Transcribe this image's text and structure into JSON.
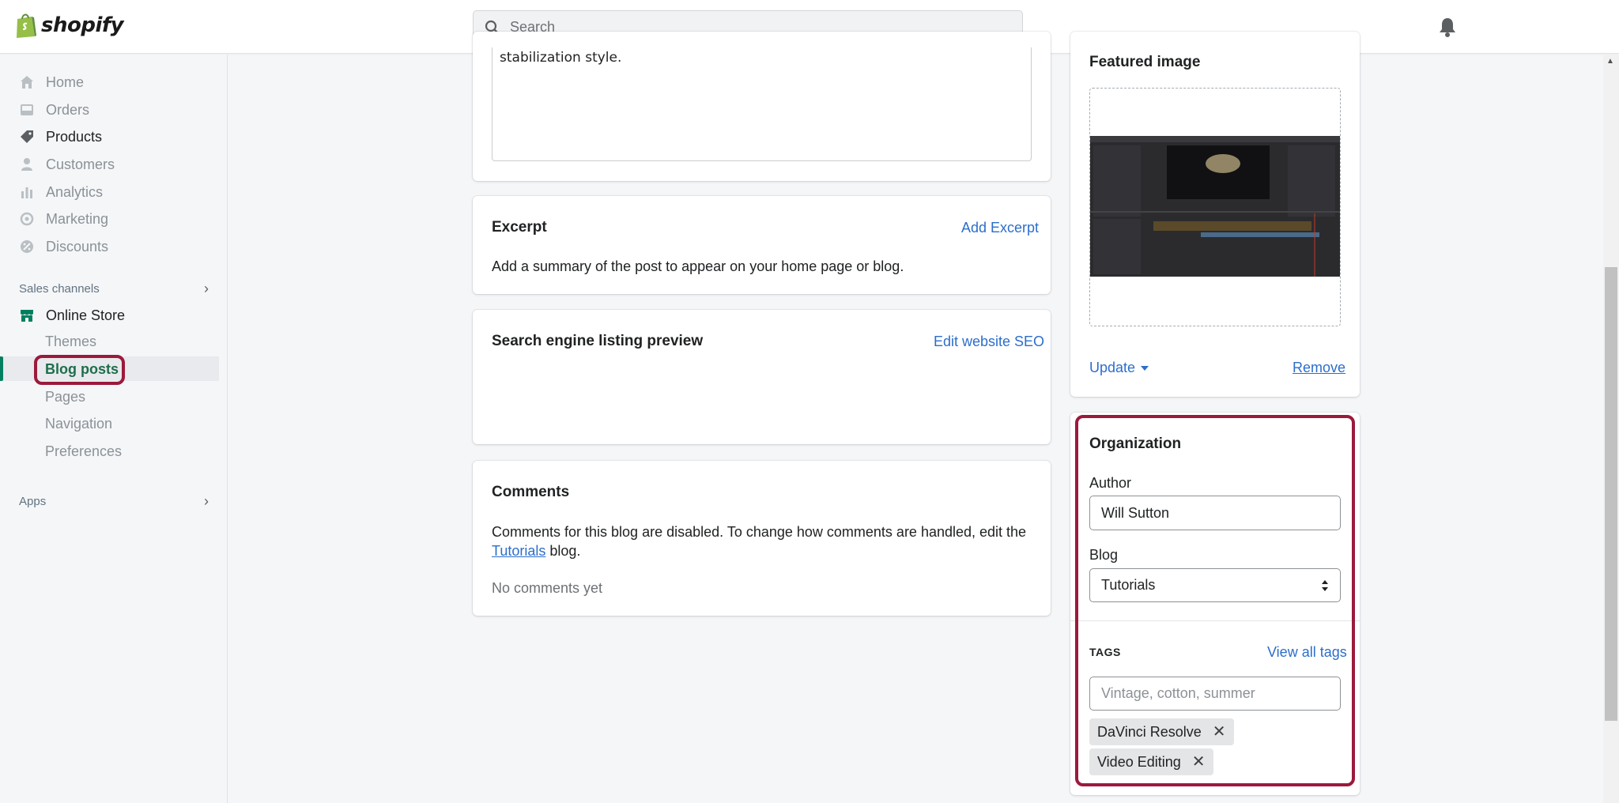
{
  "topbar": {
    "brand": "shopify",
    "search_placeholder": "Search"
  },
  "sidebar": {
    "items": [
      {
        "label": "Home",
        "icon": "home-icon"
      },
      {
        "label": "Orders",
        "icon": "inbox-icon"
      },
      {
        "label": "Products",
        "icon": "tag-icon"
      },
      {
        "label": "Customers",
        "icon": "person-icon"
      },
      {
        "label": "Analytics",
        "icon": "bar-chart-icon"
      },
      {
        "label": "Marketing",
        "icon": "target-icon"
      },
      {
        "label": "Discounts",
        "icon": "discount-icon"
      }
    ],
    "sales_channels_label": "Sales channels",
    "online_store_label": "Online Store",
    "sub_items": [
      "Themes",
      "Blog posts",
      "Pages",
      "Navigation",
      "Preferences"
    ],
    "apps_label": "Apps"
  },
  "content": {
    "content_tail_text": "stabilization style.",
    "excerpt": {
      "title": "Excerpt",
      "action": "Add Excerpt",
      "description": "Add a summary of the post to appear on your home page or blog."
    },
    "seo": {
      "title": "Search engine listing preview",
      "action": "Edit website SEO"
    },
    "comments": {
      "title": "Comments",
      "text_before": "Comments for this blog are disabled. To change how comments are handled, edit the",
      "blog_link": "Tutorials",
      "text_after": "blog.",
      "empty": "No comments yet"
    }
  },
  "featured_image": {
    "title": "Featured image",
    "update_label": "Update",
    "remove_label": "Remove"
  },
  "organization": {
    "title": "Organization",
    "author_label": "Author",
    "author_value": "Will Sutton",
    "blog_label": "Blog",
    "blog_value": "Tutorials",
    "tags_label": "TAGS",
    "view_all_tags": "View all tags",
    "tags_placeholder": "Vintage, cotton, summer",
    "tags": [
      "DaVinci Resolve",
      "Video Editing"
    ]
  },
  "colors": {
    "accent_green": "#008060",
    "link_blue": "#2c6ecb",
    "highlight": "#9b1a3b"
  }
}
